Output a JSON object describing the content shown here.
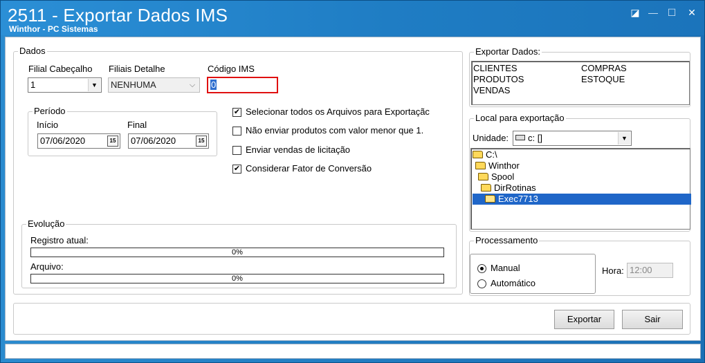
{
  "window": {
    "title": "2511 - Exportar Dados IMS",
    "subtitle": "Winthor - PC Sistemas",
    "controls": {
      "restore": "◪",
      "minimize": "—",
      "maximize": "☐",
      "close": "✕"
    }
  },
  "dados": {
    "legend": "Dados",
    "filial_cabecalho": {
      "label": "Filial Cabeçalho",
      "value": "1"
    },
    "filiais_detalhe": {
      "label": "Filiais Detalhe",
      "value": "NENHUMA"
    },
    "codigo_ims": {
      "label": "Código IMS",
      "value": "0"
    },
    "periodo": {
      "legend": "Período",
      "inicio": {
        "label": "Início",
        "value": "07/06/2020"
      },
      "final": {
        "label": "Final",
        "value": "07/06/2020"
      },
      "cal_icon": "15"
    },
    "options": [
      {
        "label": "Selecionar todos os Arquivos para Exportaçãc",
        "checked": true
      },
      {
        "label": "Não enviar produtos com valor menor que 1.",
        "checked": false
      },
      {
        "label": "Enviar vendas de licitação",
        "checked": false
      },
      {
        "label": "Considerar Fator de Conversão",
        "checked": true
      }
    ],
    "checkmark": "✔"
  },
  "evolucao": {
    "legend": "Evolução",
    "registro": {
      "label": "Registro atual:",
      "value": "0%"
    },
    "arquivo": {
      "label": "Arquivo:",
      "value": "0%"
    }
  },
  "exportar_dados": {
    "legend": "Exportar Dados:",
    "col1": [
      "CLIENTES",
      "PRODUTOS",
      "VENDAS"
    ],
    "col2": [
      "COMPRAS",
      "ESTOQUE"
    ]
  },
  "local": {
    "legend": "Local para exportação",
    "unidade_label": "Unidade:",
    "unidade_value": "c: []",
    "tree": [
      "C:\\",
      "Winthor",
      "Spool",
      "DirRotinas",
      "Exec7713"
    ],
    "selected_index": 4
  },
  "processamento": {
    "legend": "Processamento",
    "manual": "Manual",
    "automatico": "Automático",
    "selected": "Manual",
    "hora_label": "Hora:",
    "hora_value": "12:00"
  },
  "buttons": {
    "exportar": "Exportar",
    "sair": "Sair"
  }
}
